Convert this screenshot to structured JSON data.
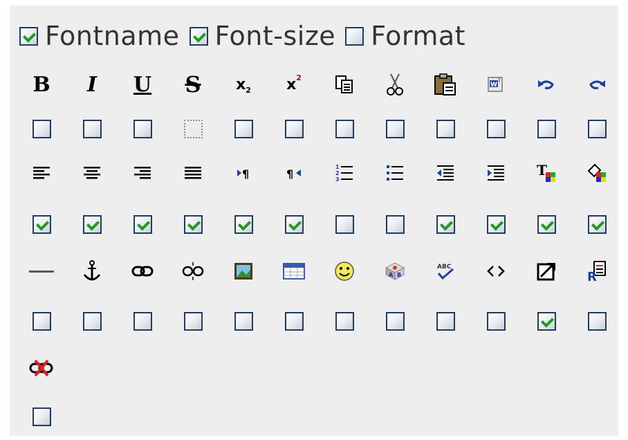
{
  "top_row": [
    {
      "label": "Fontname",
      "checked": true
    },
    {
      "label": "Font-size",
      "checked": true
    },
    {
      "label": "Format",
      "checked": false
    }
  ],
  "toolbar_groups": [
    {
      "buttons": [
        {
          "icon": "bold-icon",
          "glyph": "B",
          "checked": false
        },
        {
          "icon": "italic-icon",
          "glyph": "I",
          "checked": false
        },
        {
          "icon": "underline-icon",
          "glyph": "U",
          "checked": false
        },
        {
          "icon": "strikethrough-icon",
          "glyph": "S",
          "checked": false,
          "dotted": true
        },
        {
          "icon": "subscript-icon",
          "glyph": "x",
          "checked": false
        },
        {
          "icon": "superscript-icon",
          "glyph": "x",
          "checked": false
        },
        {
          "icon": "copy-icon",
          "checked": false
        },
        {
          "icon": "cut-icon",
          "checked": false
        },
        {
          "icon": "paste-icon",
          "checked": false
        },
        {
          "icon": "paste-word-icon",
          "checked": false
        },
        {
          "icon": "undo-icon",
          "checked": false
        },
        {
          "icon": "redo-icon",
          "checked": false
        }
      ]
    },
    {
      "buttons": [
        {
          "icon": "align-left-icon",
          "checked": true
        },
        {
          "icon": "align-center-icon",
          "checked": true
        },
        {
          "icon": "align-right-icon",
          "checked": true
        },
        {
          "icon": "align-justify-icon",
          "checked": true
        },
        {
          "icon": "ltr-icon",
          "checked": true
        },
        {
          "icon": "rtl-icon",
          "checked": true
        },
        {
          "icon": "ordered-list-icon",
          "checked": false
        },
        {
          "icon": "unordered-list-icon",
          "checked": false
        },
        {
          "icon": "outdent-icon",
          "checked": true
        },
        {
          "icon": "indent-icon",
          "checked": true
        },
        {
          "icon": "text-color-icon",
          "checked": true
        },
        {
          "icon": "background-color-icon",
          "checked": true
        }
      ]
    },
    {
      "buttons": [
        {
          "icon": "horizontal-rule-icon",
          "checked": false
        },
        {
          "icon": "anchor-icon",
          "checked": false
        },
        {
          "icon": "link-icon",
          "checked": false
        },
        {
          "icon": "unlink-icon",
          "checked": false
        },
        {
          "icon": "image-icon",
          "checked": false
        },
        {
          "icon": "table-icon",
          "checked": false
        },
        {
          "icon": "smiley-icon",
          "checked": false
        },
        {
          "icon": "special-char-icon",
          "checked": false
        },
        {
          "icon": "spellcheck-icon",
          "checked": false
        },
        {
          "icon": "html-source-icon",
          "checked": false
        },
        {
          "icon": "popup-icon",
          "checked": true
        },
        {
          "icon": "preview-icon",
          "checked": false
        }
      ]
    },
    {
      "buttons": [
        {
          "icon": "remove-link-icon",
          "checked": false
        }
      ]
    }
  ],
  "colors": {
    "panel_bg": "#eeeeee",
    "checkbox_border": "#1f3b5e",
    "check_mark": "#1e9a1e",
    "label_text": "#333333"
  }
}
